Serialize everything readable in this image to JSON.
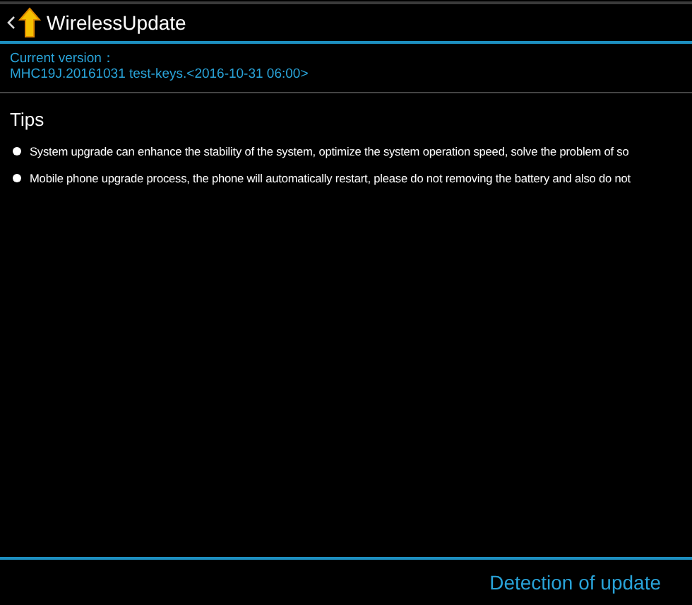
{
  "header": {
    "title": "WirelessUpdate"
  },
  "version": {
    "label": "Current version：",
    "value": "MHC19J.20161031 test-keys.<2016-10-31 06:00>"
  },
  "tips": {
    "title": "Tips",
    "items": [
      "System upgrade can enhance the stability of the system, optimize the system operation speed, solve the problem of so",
      "Mobile phone upgrade process, the phone will automatically restart, please do not removing the battery and also do not"
    ]
  },
  "action": {
    "label": "Detection of update"
  }
}
